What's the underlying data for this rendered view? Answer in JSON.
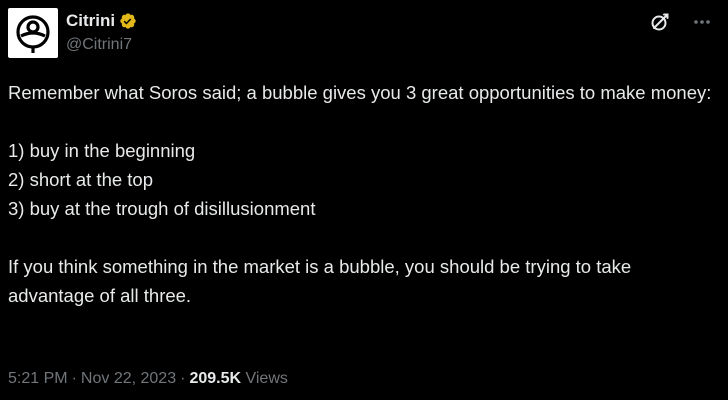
{
  "author": {
    "display_name": "Citrini",
    "handle": "@Citrini7",
    "verified_icon": "verified-badge-icon",
    "avatar_icon": "citrini-logo-icon"
  },
  "actions": {
    "grok_icon": "grok-icon",
    "more_icon": "more-options-icon"
  },
  "tweet": {
    "lines": [
      "Remember what Soros said; a bubble gives you 3 great opportunities to make money:",
      "1) buy in the beginning",
      "2) short at the top",
      "3) buy at the trough of disillusionment",
      "If you think something in the market is a bubble, you should be trying to take advantage of all three."
    ]
  },
  "meta": {
    "time": "5:21 PM",
    "date": "Nov 22, 2023",
    "separator": "·",
    "views_count": "209.5K",
    "views_label": "Views"
  },
  "colors": {
    "background": "#000000",
    "text": "#e7e9ea",
    "secondary": "#71767b",
    "verified_gold": "#e2b719"
  }
}
